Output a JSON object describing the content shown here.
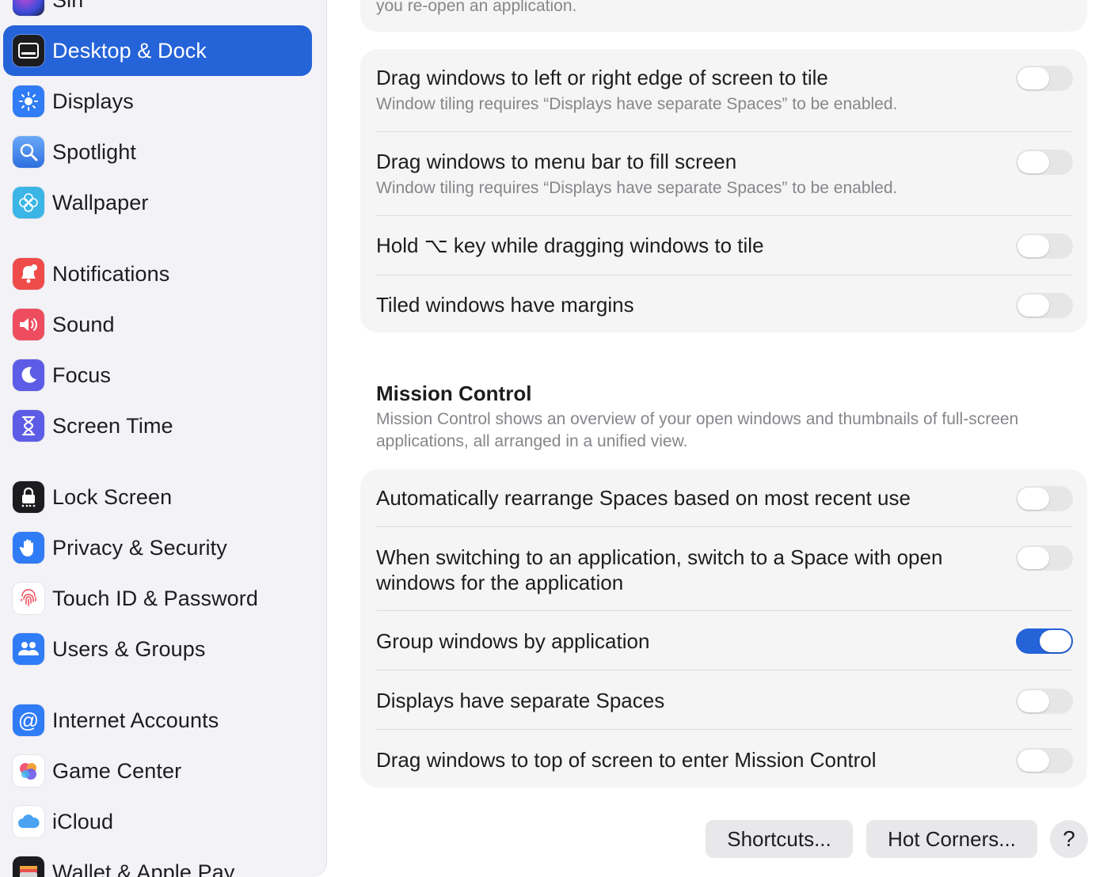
{
  "sidebar": {
    "items": [
      {
        "label": "Siri"
      },
      {
        "label": "Desktop & Dock"
      },
      {
        "label": "Displays"
      },
      {
        "label": "Spotlight"
      },
      {
        "label": "Wallpaper"
      },
      {
        "label": "Notifications"
      },
      {
        "label": "Sound"
      },
      {
        "label": "Focus"
      },
      {
        "label": "Screen Time"
      },
      {
        "label": "Lock Screen"
      },
      {
        "label": "Privacy & Security"
      },
      {
        "label": "Touch ID & Password"
      },
      {
        "label": "Users & Groups"
      },
      {
        "label": "Internet Accounts"
      },
      {
        "label": "Game Center"
      },
      {
        "label": "iCloud"
      },
      {
        "label": "Wallet & Apple Pay"
      }
    ]
  },
  "main": {
    "top_cutoff_text": "you re-open an application.",
    "tiling": {
      "rows": [
        {
          "title": "Drag windows to left or right edge of screen to tile",
          "subtitle": "Window tiling requires “Displays have separate Spaces” to be enabled.",
          "on": false
        },
        {
          "title": "Drag windows to menu bar to fill screen",
          "subtitle": "Window tiling requires “Displays have separate Spaces” to be enabled.",
          "on": false
        },
        {
          "title": "Hold ⌥ key while dragging windows to tile",
          "on": false
        },
        {
          "title": "Tiled windows have margins",
          "on": false
        }
      ]
    },
    "mission_control": {
      "title": "Mission Control",
      "description": "Mission Control shows an overview of your open windows and thumbnails of full-screen applications, all arranged in a unified view.",
      "rows": [
        {
          "title": "Automatically rearrange Spaces based on most recent use",
          "on": false
        },
        {
          "title": "When switching to an application, switch to a Space with open windows for the application",
          "on": false
        },
        {
          "title": "Group windows by application",
          "on": true
        },
        {
          "title": "Displays have separate Spaces",
          "on": false
        },
        {
          "title": "Drag windows to top of screen to enter Mission Control",
          "on": false
        }
      ]
    },
    "buttons": {
      "shortcuts": "Shortcuts...",
      "hot_corners": "Hot Corners...",
      "help": "?"
    }
  },
  "colors": {
    "accent": "#2563d8",
    "sidebar_bg": "#f3f2f7",
    "group_bg": "#f5f5f5"
  }
}
